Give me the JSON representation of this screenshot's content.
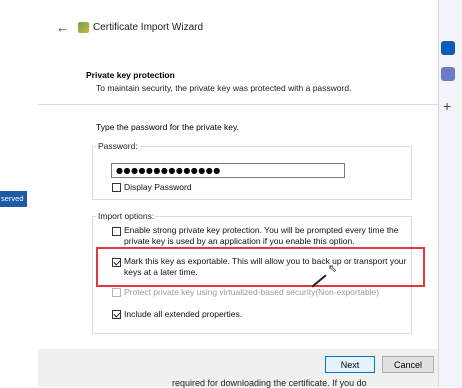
{
  "background": {
    "badge_text": "served"
  },
  "wizard": {
    "title": "Certificate Import Wizard"
  },
  "section": {
    "title": "Private key protection",
    "description": "To maintain security, the private key was protected with a password."
  },
  "prompt": "Type the password for the private key.",
  "password": {
    "label": "Password:",
    "value": "●●●●●●●●●●●●●●"
  },
  "display_password": {
    "label": "Display Password",
    "checked": false
  },
  "import_options": {
    "label": "Import options:",
    "items": [
      {
        "label_line1": "Enable strong private key protection. You will be prompted every time the",
        "label_line2": "private key is used by an application if you enable this option.",
        "checked": false,
        "enabled": true
      },
      {
        "label_line1": "Mark this key as exportable. This will allow you to back up or transport your",
        "label_line2": "keys at a later time.",
        "checked": true,
        "enabled": true
      },
      {
        "label_line1": "Protect private key using virtualized-based security(Non-exportable)",
        "label_line2": "",
        "checked": false,
        "enabled": false
      },
      {
        "label_line1": "Include all extended properties.",
        "label_line2": "",
        "checked": true,
        "enabled": true
      }
    ]
  },
  "buttons": {
    "next": "Next",
    "cancel": "Cancel"
  },
  "bottom_text": "required for downloading the certificate. If you do",
  "colors": {
    "highlight": "#e2383d",
    "primary_border": "#0078d7"
  }
}
